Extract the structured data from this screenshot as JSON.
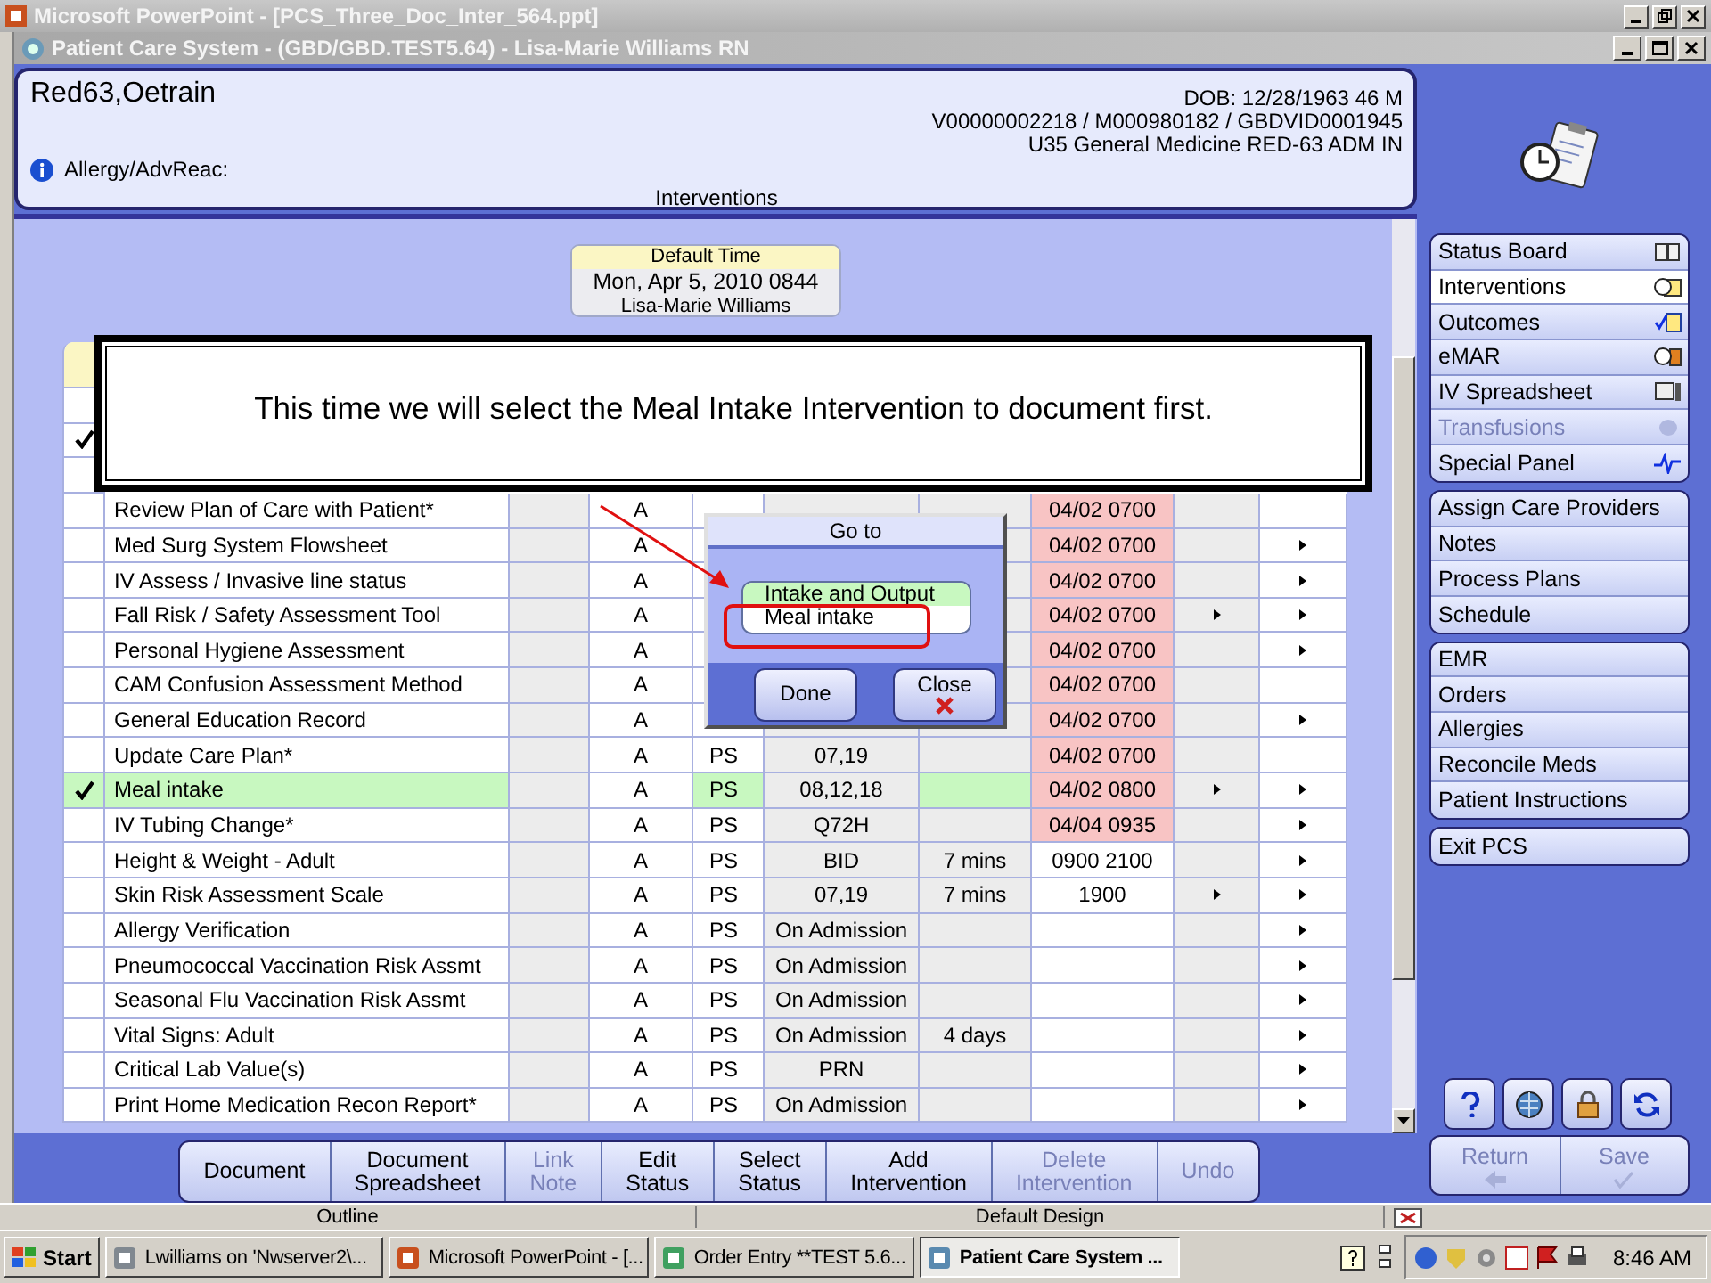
{
  "powerpoint_window": {
    "title": "Microsoft PowerPoint - [PCS_Three_Doc_Inter_564.ppt]"
  },
  "window": {
    "title": "Patient Care System - (GBD/GBD.TEST5.64) - Lisa-Marie Williams RN"
  },
  "patient": {
    "name": "Red63,Oetrain",
    "dob": "DOB: 12/28/1963 46 M",
    "ids": "V00000002218 / M000980182 / GBDVID0001945",
    "location": "U35 General Medicine  RED-63  ADM IN",
    "allergy_label": "Allergy/AdvReac:"
  },
  "view_title": "Interventions",
  "default_time": {
    "label": "Default Time",
    "datetime": "Mon, Apr 5, 2010  0844",
    "user": "Lisa-Marie Williams"
  },
  "callout": {
    "text": "This time we will select the Meal Intake Intervention to document first."
  },
  "table": {
    "covered_rows": [
      {
        "checked": false
      },
      {
        "checked": true
      },
      {
        "checked": false
      }
    ],
    "rows": [
      {
        "name": "Review Plan of Care with Patient*",
        "checked": false,
        "selected": false,
        "status": "A",
        "due": "04/02 0700",
        "overdue": true,
        "arrow_1": false,
        "arrow_2": false
      },
      {
        "name": "Med Surg System Flowsheet",
        "checked": false,
        "selected": false,
        "status": "A",
        "due": "04/02 0700",
        "overdue": true,
        "arrow_1": false,
        "arrow_2": true
      },
      {
        "name": "IV Assess / Invasive line status",
        "checked": false,
        "selected": false,
        "status": "A",
        "due": "04/02 0700",
        "overdue": true,
        "arrow_1": false,
        "arrow_2": true
      },
      {
        "name": "Fall Risk / Safety Assessment Tool",
        "checked": false,
        "selected": false,
        "status": "A",
        "due": "04/02 0700",
        "overdue": true,
        "arrow_1": true,
        "arrow_2": true
      },
      {
        "name": "Personal Hygiene Assessment",
        "checked": false,
        "selected": false,
        "status": "A",
        "due": "04/02 0700",
        "overdue": true,
        "arrow_1": false,
        "arrow_2": true
      },
      {
        "name": "CAM Confusion Assessment Method",
        "checked": false,
        "selected": false,
        "status": "A",
        "due": "04/02 0700",
        "overdue": true,
        "arrow_1": false,
        "arrow_2": false
      },
      {
        "name": "General Education Record",
        "checked": false,
        "selected": false,
        "status": "A",
        "due": "04/02 0700",
        "overdue": true,
        "arrow_1": false,
        "arrow_2": true
      },
      {
        "name": "Update Care Plan*",
        "checked": false,
        "selected": false,
        "status": "A",
        "ps": "PS",
        "frequency": "07,19",
        "due": "04/02 0700",
        "overdue": true,
        "arrow_1": false,
        "arrow_2": false
      },
      {
        "name": "Meal intake",
        "checked": true,
        "selected": true,
        "status": "A",
        "ps": "PS",
        "frequency": "08,12,18",
        "due": "04/02 0800",
        "overdue": true,
        "arrow_1": true,
        "arrow_2": true
      },
      {
        "name": "IV Tubing Change*",
        "checked": false,
        "selected": false,
        "status": "A",
        "ps": "PS",
        "frequency": "Q72H",
        "due": "04/04 0935",
        "overdue": true,
        "arrow_1": false,
        "arrow_2": true
      },
      {
        "name": "Height & Weight - Adult",
        "checked": false,
        "selected": false,
        "status": "A",
        "ps": "PS",
        "frequency": "BID",
        "duration": "7 mins",
        "due": "0900 2100",
        "overdue": false,
        "arrow_1": false,
        "arrow_2": true
      },
      {
        "name": "Skin Risk Assessment Scale",
        "checked": false,
        "selected": false,
        "status": "A",
        "ps": "PS",
        "frequency": "07,19",
        "duration": "7 mins",
        "due": "1900",
        "overdue": false,
        "arrow_1": true,
        "arrow_2": true
      },
      {
        "name": "Allergy Verification",
        "checked": false,
        "selected": false,
        "status": "A",
        "ps": "PS",
        "frequency": "On Admission",
        "overdue": false,
        "arrow_1": false,
        "arrow_2": true
      },
      {
        "name": "Pneumococcal Vaccination Risk Assmt",
        "checked": false,
        "selected": false,
        "status": "A",
        "ps": "PS",
        "frequency": "On Admission",
        "overdue": false,
        "arrow_1": false,
        "arrow_2": true
      },
      {
        "name": "Seasonal Flu Vaccination Risk Assmt",
        "checked": false,
        "selected": false,
        "status": "A",
        "ps": "PS",
        "frequency": "On Admission",
        "overdue": false,
        "arrow_1": false,
        "arrow_2": true
      },
      {
        "name": "Vital Signs: Adult",
        "checked": false,
        "selected": false,
        "status": "A",
        "ps": "PS",
        "frequency": "On Admission",
        "duration": "4 days",
        "overdue": false,
        "arrow_1": false,
        "arrow_2": true
      },
      {
        "name": "Critical Lab Value(s)",
        "checked": false,
        "selected": false,
        "status": "A",
        "ps": "PS",
        "frequency": "PRN",
        "overdue": false,
        "arrow_1": false,
        "arrow_2": true
      },
      {
        "name": "Print Home Medication Recon Report*",
        "checked": false,
        "selected": false,
        "status": "A",
        "ps": "PS",
        "frequency": "On Admission",
        "overdue": false,
        "arrow_1": false,
        "arrow_2": true
      }
    ]
  },
  "popup": {
    "title": "Go to",
    "items": [
      {
        "label": "Intake and Output",
        "selected": true
      },
      {
        "label": "Meal intake",
        "selected": false
      }
    ],
    "buttons": [
      {
        "label": "Done",
        "kind": "done"
      },
      {
        "label": "Close",
        "kind": "close"
      }
    ]
  },
  "sidebar": {
    "groups": [
      {
        "items": [
          {
            "label": "Status Board",
            "selected": false,
            "disabled": false
          },
          {
            "label": "Interventions",
            "selected": true,
            "disabled": false
          },
          {
            "label": "Outcomes",
            "selected": false,
            "disabled": false
          },
          {
            "label": "eMAR",
            "selected": false,
            "disabled": false
          },
          {
            "label": "IV Spreadsheet",
            "selected": false,
            "disabled": false
          },
          {
            "label": "Transfusions",
            "selected": false,
            "disabled": true
          },
          {
            "label": "Special Panel",
            "selected": false,
            "disabled": false
          }
        ]
      },
      {
        "items": [
          {
            "label": "Assign Care Providers",
            "selected": false,
            "disabled": false
          },
          {
            "label": "Notes",
            "selected": false,
            "disabled": false
          },
          {
            "label": "Process Plans",
            "selected": false,
            "disabled": false
          },
          {
            "label": "Schedule",
            "selected": false,
            "disabled": false
          }
        ]
      },
      {
        "items": [
          {
            "label": "EMR",
            "selected": false,
            "disabled": false
          },
          {
            "label": "Orders",
            "selected": false,
            "disabled": false
          },
          {
            "label": "Allergies",
            "selected": false,
            "disabled": false
          },
          {
            "label": "Reconcile Meds",
            "selected": false,
            "disabled": false
          },
          {
            "label": "Patient Instructions",
            "selected": false,
            "disabled": false
          }
        ]
      },
      {
        "items": [
          {
            "label": "Exit PCS",
            "selected": false,
            "disabled": false
          }
        ]
      }
    ]
  },
  "toolbar": {
    "buttons": [
      {
        "label": "Document",
        "disabled": false
      },
      {
        "label": "Document\nSpreadsheet",
        "disabled": false
      },
      {
        "label": "Link\nNote",
        "disabled": true
      },
      {
        "label": "Edit\nStatus",
        "disabled": false
      },
      {
        "label": "Select\nStatus",
        "disabled": false
      },
      {
        "label": "Add\nIntervention",
        "disabled": false
      },
      {
        "label": "Delete\nIntervention",
        "disabled": true
      },
      {
        "label": "Undo",
        "disabled": true
      }
    ]
  },
  "action_buttons": [
    {
      "label": "Return",
      "kind": "return",
      "disabled": true
    },
    {
      "label": "Save",
      "kind": "save",
      "disabled": true
    }
  ],
  "status_bar": [
    "Outline",
    "Default Design"
  ],
  "taskbar": {
    "start": "Start",
    "tasks": [
      {
        "label": "Lwilliams on 'Nwserver2\\...",
        "active": false
      },
      {
        "label": "Microsoft PowerPoint - [...",
        "active": false
      },
      {
        "label": "Order Entry **TEST 5.6...",
        "active": false
      },
      {
        "label": "Patient Care System ...",
        "active": true
      }
    ],
    "clock": "8:46 AM"
  }
}
